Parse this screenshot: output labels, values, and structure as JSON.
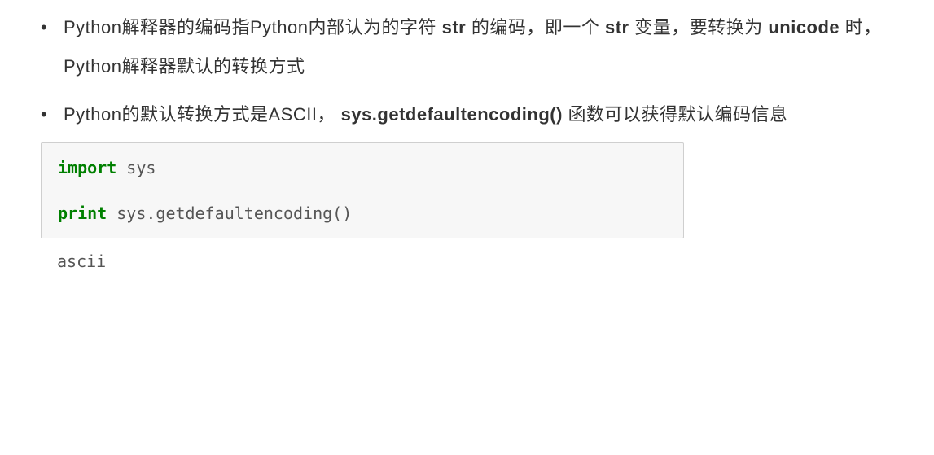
{
  "bullets": [
    {
      "parts": [
        {
          "text": "Python解释器的编码指Python内部认为的字符 ",
          "bold": false
        },
        {
          "text": "str",
          "bold": true
        },
        {
          "text": " 的编码，即一个 ",
          "bold": false
        },
        {
          "text": "str",
          "bold": true
        },
        {
          "text": " 变量，要转换为 ",
          "bold": false
        },
        {
          "text": "unicode",
          "bold": true
        },
        {
          "text": " 时，Python解释器默认的转换方式",
          "bold": false
        }
      ]
    },
    {
      "parts": [
        {
          "text": "Python的默认转换方式是ASCII， ",
          "bold": false
        },
        {
          "text": "sys.getdefaultencoding()",
          "bold": true
        },
        {
          "text": " 函数可以获得默认编码信息",
          "bold": false
        }
      ]
    }
  ],
  "code": {
    "line1_kw": "import",
    "line1_rest": " sys",
    "line2_kw": "print",
    "line2_rest": " sys.getdefaultencoding()"
  },
  "output": "ascii"
}
